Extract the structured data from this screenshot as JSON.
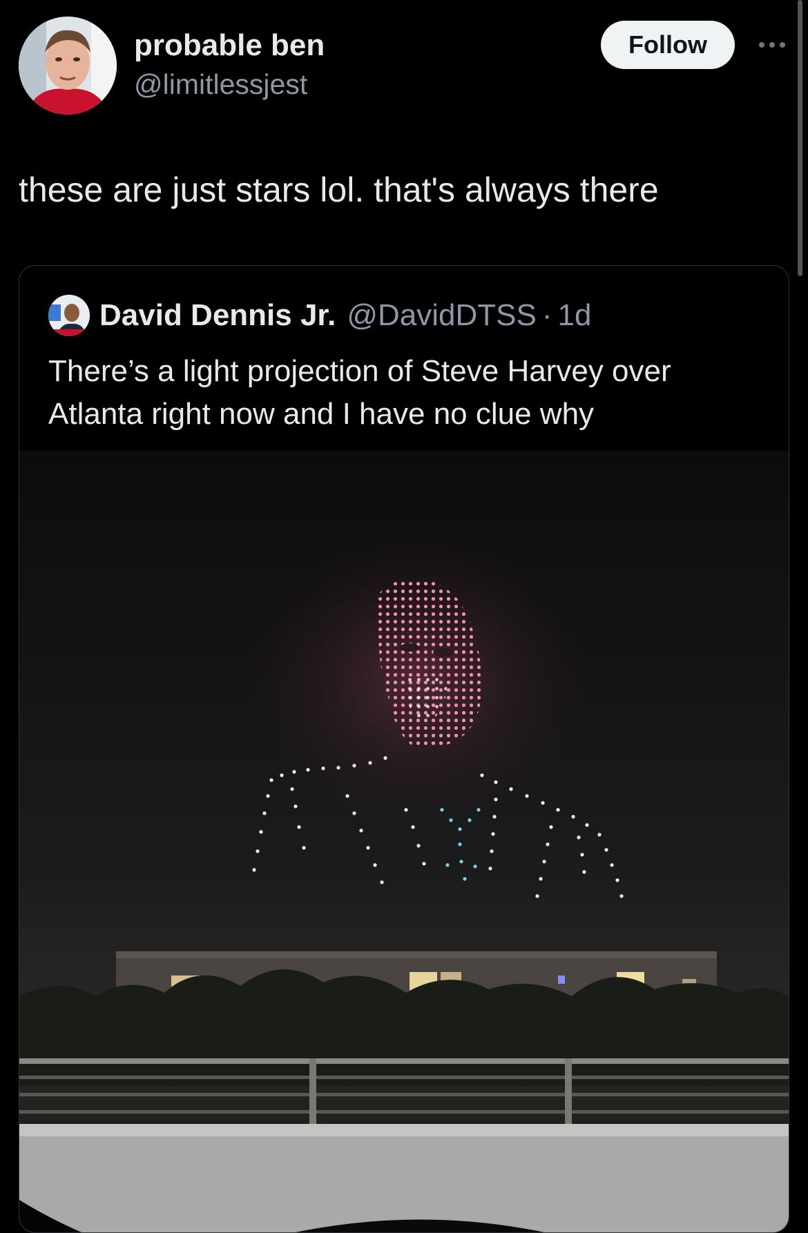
{
  "author": {
    "display_name": "probable ben",
    "handle": "@limitlessjest"
  },
  "actions": {
    "follow_label": "Follow",
    "more_icon": "more-horizontal-icon"
  },
  "tweet": {
    "text": "these are just stars lol. that's always there"
  },
  "quoted": {
    "display_name": "David Dennis Jr.",
    "handle": "@DavidDTSS",
    "separator": "·",
    "time": "1d",
    "text": "There’s a light projection of Steve Harvey over Atlanta right now and I have no clue why"
  },
  "colors": {
    "background": "#000000",
    "text": "#e7e9ea",
    "secondary": "#8b98a5",
    "follow_bg": "#eff3f4"
  }
}
